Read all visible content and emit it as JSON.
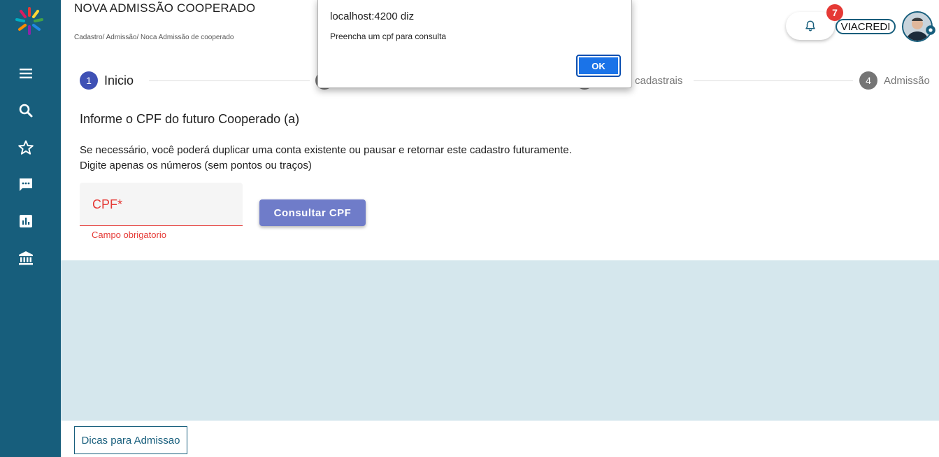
{
  "header": {
    "title": "NOVA ADMISSÃO COOPERADO",
    "breadcrumb": "Cadastro/ Admissão/ Noca Admissão de cooperado",
    "notification_count": "7",
    "cooperative": "VIACREDI"
  },
  "sidebar": {
    "items": [
      {
        "icon": "menu-icon"
      },
      {
        "icon": "search-icon"
      },
      {
        "icon": "star-icon"
      },
      {
        "icon": "chat-icon"
      },
      {
        "icon": "bar-chart-icon"
      },
      {
        "icon": "bank-icon"
      }
    ]
  },
  "stepper": {
    "steps": [
      {
        "number": "1",
        "label": "Inicio",
        "active": true
      },
      {
        "number": "",
        "label": "",
        "active": false
      },
      {
        "number": "",
        "label": "cadastrais",
        "active": false
      },
      {
        "number": "4",
        "label": "Admissão",
        "active": false
      }
    ]
  },
  "form": {
    "heading": "Informe o CPF do futuro Cooperado (a)",
    "description_line1": "Se necessário, você poderá duplicar uma conta existente ou pausar e retornar este cadastro futuramente.",
    "description_line2": "Digite apenas os números (sem pontos ou traços)",
    "cpf_label": "CPF*",
    "cpf_value": "",
    "cpf_error": "Campo obrigatorio",
    "consult_button": "Consultar CPF"
  },
  "footer": {
    "tips_button": "Dicas para Admissao"
  },
  "dialog": {
    "title": "localhost:4200 diz",
    "message": "Preencha um cpf para consulta",
    "ok_label": "OK"
  },
  "colors": {
    "sidebar": "#175e7c",
    "step_active": "#3f51b5",
    "step_inactive": "#757575",
    "error": "#e53935",
    "primary_button": "#6f7cc9",
    "panel": "#d5e7ed",
    "dialog_ok": "#1a73e8"
  }
}
